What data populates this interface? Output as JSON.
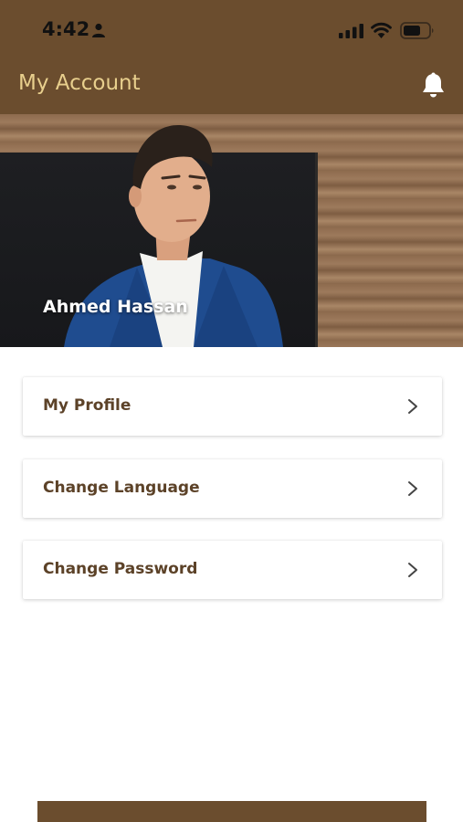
{
  "status_bar": {
    "time": "4:42",
    "icons": [
      "person-icon",
      "signal-icon",
      "wifi-icon",
      "battery-icon"
    ]
  },
  "header": {
    "title": "My Account",
    "notification_icon": "bell-icon",
    "background_color": "#6b4d2e",
    "title_color": "#e8cf8d"
  },
  "profile": {
    "name": "Ahmed Hassan"
  },
  "menu": {
    "items": [
      {
        "label": "My Profile",
        "icon": "chevron-right-icon"
      },
      {
        "label": "Change Language",
        "icon": "chevron-right-icon"
      },
      {
        "label": "Change Password",
        "icon": "chevron-right-icon"
      }
    ],
    "label_color": "#5c4228"
  },
  "bottom_action": {
    "color": "#6b4d2e"
  }
}
